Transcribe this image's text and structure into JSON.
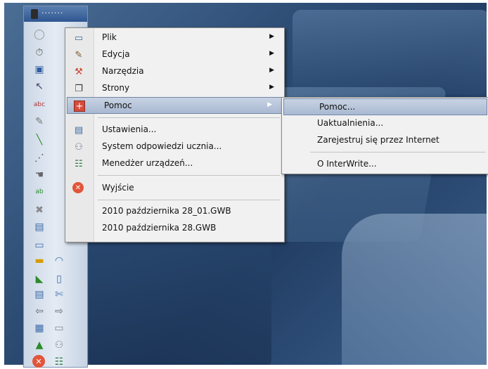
{
  "toolbar": {
    "title_dots": "·······"
  },
  "main_menu": {
    "items": [
      {
        "label": "Plik",
        "icon": "folder-icon"
      },
      {
        "label": "Edycja",
        "icon": "edit-icon"
      },
      {
        "label": "Narzędzia",
        "icon": "tools-icon"
      },
      {
        "label": "Strony",
        "icon": "pages-icon"
      },
      {
        "label": "Pomoc",
        "icon": "help-icon"
      },
      {
        "label": "Ustawienia...",
        "icon": "settings-icon"
      },
      {
        "label": "System odpowiedzi ucznia...",
        "icon": "response-system-icon"
      },
      {
        "label": "Menedżer urządzeń...",
        "icon": "device-manager-icon"
      },
      {
        "label": "Wyjście",
        "icon": "exit-icon"
      },
      {
        "label": "2010 października 28_01.GWB"
      },
      {
        "label": "2010 października 28.GWB"
      }
    ]
  },
  "sub_menu": {
    "items": [
      {
        "label": "Pomoc..."
      },
      {
        "label": "Uaktualnienia..."
      },
      {
        "label": "Zarejestruj się przez Internet"
      },
      {
        "label": "O InterWrite..."
      }
    ]
  },
  "colors": {
    "highlight": "#b7c4d9",
    "menu_bg": "#f1f1f1",
    "exit_red": "#e2553a",
    "toolbar_title": "#3a63a0"
  }
}
